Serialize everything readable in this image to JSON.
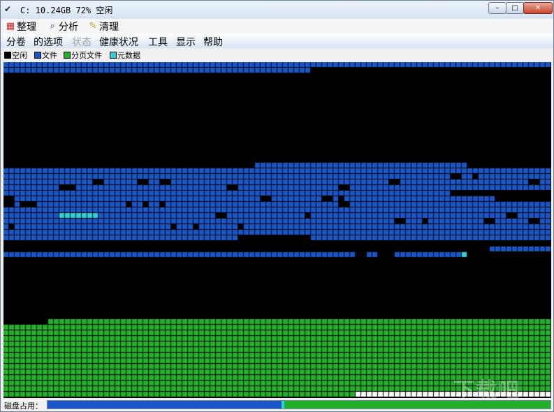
{
  "window": {
    "title": "C:  10.24GB 72% 空闲",
    "app_icon_glyph": "✔",
    "minimize_glyph": "–",
    "maximize_glyph": "□",
    "close_glyph": "✕"
  },
  "toolbar": [
    {
      "label": "整理",
      "icon": "defrag-icon",
      "glyph": "▦",
      "color": "#c0282d"
    },
    {
      "label": "分析",
      "icon": "magnifier-icon",
      "glyph": "⌕",
      "color": "#2a5db0"
    },
    {
      "label": "清理",
      "icon": "broom-icon",
      "glyph": "✎",
      "color": "#c89b2a"
    }
  ],
  "menu": [
    {
      "label": "分卷",
      "enabled": true
    },
    {
      "label": "的选项",
      "enabled": true
    },
    {
      "label": "状态",
      "enabled": false
    },
    {
      "label": "健康状况",
      "enabled": true
    },
    {
      "label": "工具",
      "enabled": true
    },
    {
      "label": "显示",
      "enabled": true
    },
    {
      "label": "帮助",
      "enabled": true
    }
  ],
  "legend": [
    {
      "label": "空闲",
      "color": "#000000"
    },
    {
      "label": "文件",
      "color": "#1a56c8"
    },
    {
      "label": "分页文件",
      "color": "#22b02a"
    },
    {
      "label": "元数据",
      "color": "#2fd0d8"
    }
  ],
  "colors": {
    "free": "#000000",
    "file": "#1a56c8",
    "pagefile": "#22b02a",
    "metadata": "#2fd0d8",
    "gridline": "#0a2a6a"
  },
  "status": {
    "label": "磁盘占用："
  },
  "usage": {
    "file_fraction": 0.465,
    "metadata_fraction": 0.006,
    "pagefile_fraction": 0.529,
    "file_color": "#1a56c8",
    "metadata_color": "#2fd0d8",
    "pagefile_color": "#22b02a"
  },
  "watermark": "下载吧"
}
